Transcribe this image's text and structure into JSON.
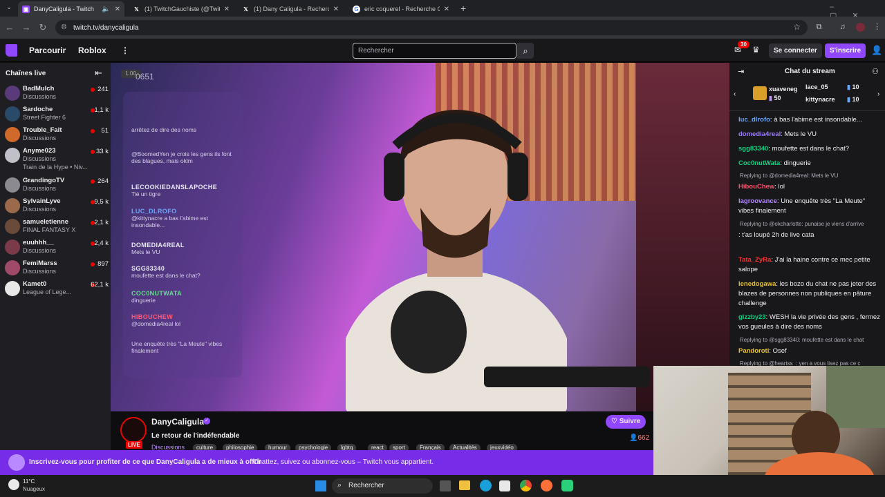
{
  "browser": {
    "tabs": [
      {
        "title": "DanyCaligula - Twitch",
        "active": true
      },
      {
        "title": "(1) TwitchGauchiste (@TwitchG"
      },
      {
        "title": "(1) Dany Caligula - Recherche /"
      },
      {
        "title": "eric coquerel - Recherche Goog"
      }
    ],
    "url": "twitch.tv/danycaligula"
  },
  "topnav": {
    "browse": "Parcourir",
    "roblox": "Roblox",
    "search_placeholder": "Rechercher",
    "notif_count": "30",
    "login": "Se connecter",
    "signup": "S'inscrire"
  },
  "sidebar": {
    "title": "Chaînes live",
    "channels": [
      {
        "name": "BadMulch",
        "category": "Discussions",
        "viewers": "241",
        "color": "#5a3a7a"
      },
      {
        "name": "Sardoche",
        "category": "Street Fighter 6",
        "viewers": "1,1 k",
        "color": "#2a4a6a"
      },
      {
        "name": "Trouble_Fait",
        "category": "Discussions",
        "viewers": "51",
        "color": "#d06a2a"
      },
      {
        "name": "Anyme023",
        "category": "Discussions",
        "extra": "Train de la Hype • Niv...",
        "viewers": "33 k",
        "color": "#c0c0c8"
      },
      {
        "name": "GrandingoTV",
        "category": "Discussions",
        "viewers": "264",
        "color": "#8a8a90"
      },
      {
        "name": "SylvainLyve",
        "category": "Discussions",
        "viewers": "9,5 k",
        "color": "#9a6a4a"
      },
      {
        "name": "samueletienne",
        "category": "FINAL FANTASY X",
        "viewers": "2,1 k",
        "color": "#6a4a3a"
      },
      {
        "name": "euuhhh__",
        "category": "Discussions",
        "viewers": "2,4 k",
        "color": "#7a3a4a"
      },
      {
        "name": "FemiMarss",
        "category": "Discussions",
        "viewers": "897",
        "color": "#a04a6a"
      },
      {
        "name": "Kamet0",
        "category": "League of Lege...",
        "viewers": "62,1 k",
        "color": "#e8e8e8"
      }
    ]
  },
  "player": {
    "bitrate_label": "1.00",
    "overlay_number": "0651",
    "overlay_chat": [
      {
        "user": "",
        "msg": "arrêtez de dire des noms",
        "color": "#ff7ab0"
      },
      {
        "user": "",
        "msg": "@BoomedYen je crois les gens ils font des blagues, mais oklm",
        "color": "#5fe08a"
      },
      {
        "user": "LECOOKIEDANSLAPOCHE",
        "msg": "Tié un tigre",
        "color": "#e8e8f0"
      },
      {
        "user": "LUC_DLROFO",
        "msg": "@kittynacre a bas l'abime est insondable...",
        "color": "#6aa8ff"
      },
      {
        "user": "DOMEDIA4REAL",
        "msg": "Mets le VU",
        "color": "#e8e8f0"
      },
      {
        "user": "SGG83340",
        "msg": "moufette est dans le chat?",
        "color": "#e8e8f0"
      },
      {
        "user": "COC0NUTWATA",
        "msg": "dinguerie",
        "color": "#5fe08a"
      },
      {
        "user": "HIBOUCHEW",
        "msg": "@domedia4real lol",
        "color": "#ff5a7a"
      },
      {
        "user": "",
        "msg": "Une enquête très \"La Meute\" vibes finalement",
        "color": "#c07aff"
      }
    ]
  },
  "stream_info": {
    "streamer": "DanyCaligula",
    "title": "Le retour de l'indéfendable",
    "live": "LIVE",
    "category": "Discussions",
    "tags": [
      "culture",
      "philosophie",
      "humour",
      "psychologie",
      "lgbtq",
      "react",
      "sport",
      "Français",
      "Actualités",
      "jeuxvidéo"
    ],
    "follow": "Suivre",
    "viewers": "662"
  },
  "chat": {
    "title": "Chat du stream",
    "gifters": [
      {
        "name": "xuaveneg",
        "count": "50"
      },
      {
        "name": "lace_05",
        "count": "10"
      },
      {
        "name": "kittynacre",
        "count": "10"
      }
    ],
    "messages": [
      {
        "user": "luc_dlrofo",
        "text": ": à bas l'abime est insondable...",
        "color": "#6aa8ff"
      },
      {
        "user": "domedia4real",
        "text": ": Mets le VU",
        "color": "#9b7bff"
      },
      {
        "user": "sgg83340",
        "text": ": moufette est dans le chat?",
        "color": "#00d37f"
      },
      {
        "user": "Coc0nutWata",
        "text": ": dinguerie",
        "color": "#00d37f"
      },
      {
        "reply": "Replying to @domedia4real: Mets le VU",
        "user": "HibouChew",
        "text": ": lol",
        "color": "#ff4f6a"
      },
      {
        "user": "lagroovance",
        "text": ": Une enquête très \"La Meute\" vibes finalement",
        "color": "#b58aff"
      },
      {
        "reply": "Replying to @okcharlotte: punaise je viens d'arrive",
        "user": "",
        "text": ": t'as loupé 2h de live cata",
        "color": "#ff3030"
      },
      {
        "user": "Tata_ZyRa",
        "text": ": J'ai la haine contre ce mec petite salope",
        "color": "#ff3030"
      },
      {
        "user": "lenedogawa",
        "text": ": les bozo du chat ne pas jeter des blazes de personnes non publiques en pâture challenge",
        "color": "#e8c030"
      },
      {
        "user": "gizzby23",
        "text": ": WESH la vie privée des gens , fermez vos gueules à dire des noms",
        "color": "#00d37f"
      },
      {
        "reply": "Replying to @sgg83340: moufette est dans le chat",
        "user": "Pandoroti",
        "text": ": Osef",
        "color": "#e8c030"
      },
      {
        "reply": "Replying to @heartss_: yen a vous lisez pas ce c",
        "user": "",
        "text": "",
        "color": "#adadb8"
      }
    ]
  },
  "promo": {
    "bold": "Inscrivez-vous pour profiter de ce que DanyCaligula a de mieux à offrir",
    "rest": "Chattez, suivez ou abonnez-vous – Twitch vous appartient."
  },
  "taskbar": {
    "temp": "11°C",
    "weather": "Nuageux",
    "search": "Rechercher"
  },
  "colors": {
    "twitch_purple": "#9147ff",
    "live_red": "#eb0400"
  }
}
